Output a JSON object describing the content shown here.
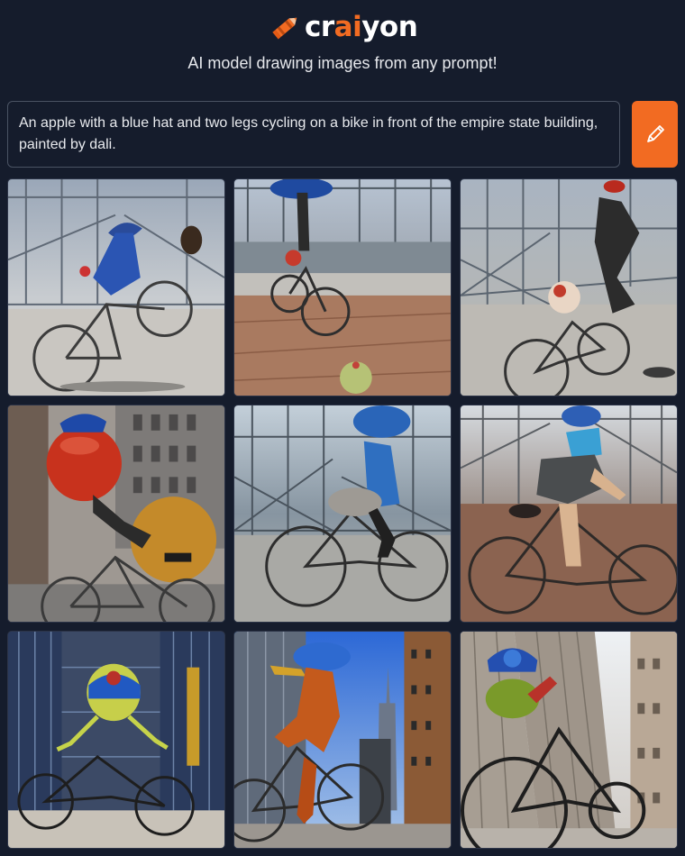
{
  "brand": {
    "name_prefix": "cr",
    "name_accent": "ai",
    "name_suffix": "yon",
    "logo_icon": "crayon-icon",
    "accent_color": "#f26b22"
  },
  "tagline": "AI model drawing images from any prompt!",
  "prompt": {
    "value": "An apple with a blue hat and two legs cycling on a bike in front of the empire state building, painted by dali.",
    "draw_button_icon": "pencil-icon"
  },
  "results": {
    "count": 9,
    "image_alt": "generated image"
  },
  "colors": {
    "background": "#151c2c",
    "accent": "#f26b22",
    "border": "#4a5363"
  }
}
